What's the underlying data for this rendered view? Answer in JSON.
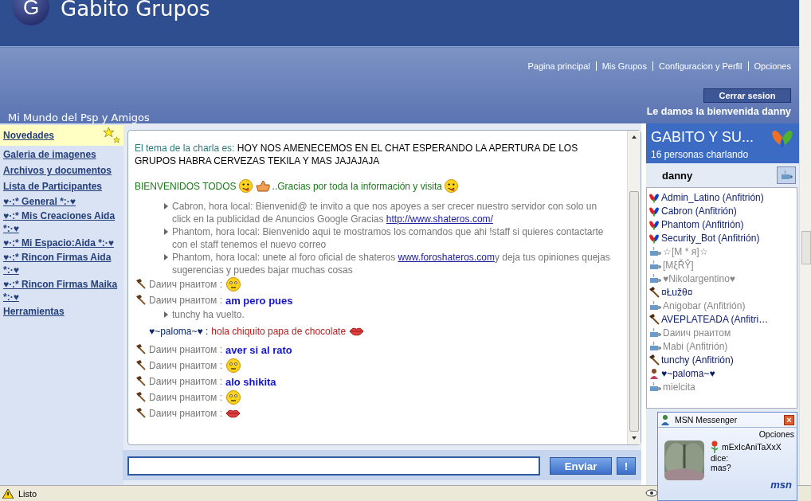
{
  "header": {
    "logo_letter": "G",
    "title": "Gabito Grupos",
    "nav": [
      "Pagina principal",
      "Mis Grupos",
      "Configuracion y Perfil",
      "Opciones"
    ],
    "logout": "Cerrar sesion",
    "welcome": "Le damos la bienvenida danny",
    "group_name": "Mi Mundo del Psp y Amigos"
  },
  "sidebar": {
    "items": [
      {
        "label": "Novedades",
        "selected": true
      },
      {
        "label": "Galeria de imagenes",
        "selected": false
      },
      {
        "label": "Archivos y documentos",
        "selected": false
      },
      {
        "label": "Lista de Participantes",
        "selected": false
      },
      {
        "label": "♥·:* General *:·♥",
        "selected": false
      },
      {
        "label": "♥·:* Mis Creaciones Aida *:·♥",
        "selected": false
      },
      {
        "label": "♥·:* Mi Espacio:Aida *:·♥",
        "selected": false
      },
      {
        "label": "♥·:* Rincon Firmas Aida *:·♥",
        "selected": false
      },
      {
        "label": "♥·:* Rincon Firmas Maika *:·♥",
        "selected": false
      },
      {
        "label": "Herramientas",
        "selected": false
      }
    ]
  },
  "chat": {
    "topic_label": "El tema de la charla es:",
    "topic": "HOY NOS AMENECEMOS EN EL CHAT ESPERANDO LA APERTURA DE LOS GRUPOS HABRA CERVEZAS TEKILA Y MAS JAJAJAJA",
    "greeting": "BIENVENIDOS TODOS",
    "greeting_more": "..Gracias por toda la información y visita",
    "messages": [
      {
        "kind": "system",
        "text": "Cabron, hora local: Bienvenid@ te invito a que nos apoyes a ser crecer nuestro servidor con solo un click en la publicidad de Anuncios Google Gracias",
        "link": "http://www.shateros.com/"
      },
      {
        "kind": "system",
        "text": "Phantom, hora local: Bienvenido aqui te mostramos los comandos que ahi !staff si quieres contactarte con el staff tenemos el nuevo correo"
      },
      {
        "kind": "system",
        "text": "Phantom, hora local: unete al foro oficial de shateros",
        "link": "www.foroshateros.com",
        "after": "y deja tus opiniones quejas sugerencias y puedes bajar muchas cosas"
      },
      {
        "kind": "smiley",
        "name": "Dаиич рнаитом :"
      },
      {
        "kind": "text",
        "name": "Dаиич рнаитом :",
        "text": "am pero pues"
      },
      {
        "kind": "system",
        "text": "tunchy ha vuelto."
      },
      {
        "kind": "guest",
        "name": "♥~paloma~♥ :",
        "text": "hola chiquito papa de chocolate"
      },
      {
        "kind": "text",
        "name": "Dаиич рнаитом :",
        "text": "aver si al rato"
      },
      {
        "kind": "smiley",
        "name": "Dаиич рнаитом :"
      },
      {
        "kind": "text",
        "name": "Dаиич рнаитом :",
        "text": "alo shikita"
      },
      {
        "kind": "smiley",
        "name": "Dаиич рнаитом :"
      },
      {
        "kind": "kiss",
        "name": "Dаиич рнаитом :"
      }
    ],
    "send": "Enviar",
    "alert": "!"
  },
  "room": {
    "title": "GABITO Y SU...",
    "count": "16 personas charlando",
    "me": "danny",
    "users": [
      {
        "name": "Admin_Latino (Anfitrión)",
        "kind": "host"
      },
      {
        "name": "Cabron (Anfitrión)",
        "kind": "host"
      },
      {
        "name": "Phantom (Anfitrión)",
        "kind": "host"
      },
      {
        "name": "Security_Bot (Anfitrión)",
        "kind": "host"
      },
      {
        "name": "☆[M * я]☆",
        "kind": "idle"
      },
      {
        "name": "[MξŘŶ]",
        "kind": "idle"
      },
      {
        "name": "♥Nikolargentino♥",
        "kind": "idle"
      },
      {
        "name": "¤Łužθ¤",
        "kind": "mod"
      },
      {
        "name": "Anigobar (Anfitrión)",
        "kind": "idle"
      },
      {
        "name": "AVEPLATEADA (Anfitri…",
        "kind": "mod"
      },
      {
        "name": "Dаиич рнаитом",
        "kind": "idle"
      },
      {
        "name": "Mabi (Anfitrión)",
        "kind": "idle"
      },
      {
        "name": "tunchy (Anfitrión)",
        "kind": "mod"
      },
      {
        "name": "♥~paloma~♥",
        "kind": "avatar"
      },
      {
        "name": "mielcita",
        "kind": "idle"
      }
    ]
  },
  "popup": {
    "title": "MSN Messenger",
    "close": "×",
    "options": "Opciones",
    "sender": "mExIcAniTaXxX",
    "says": "dice:",
    "message": "mas?",
    "brand": "msn"
  },
  "status_bar": {
    "text": "Listo"
  }
}
